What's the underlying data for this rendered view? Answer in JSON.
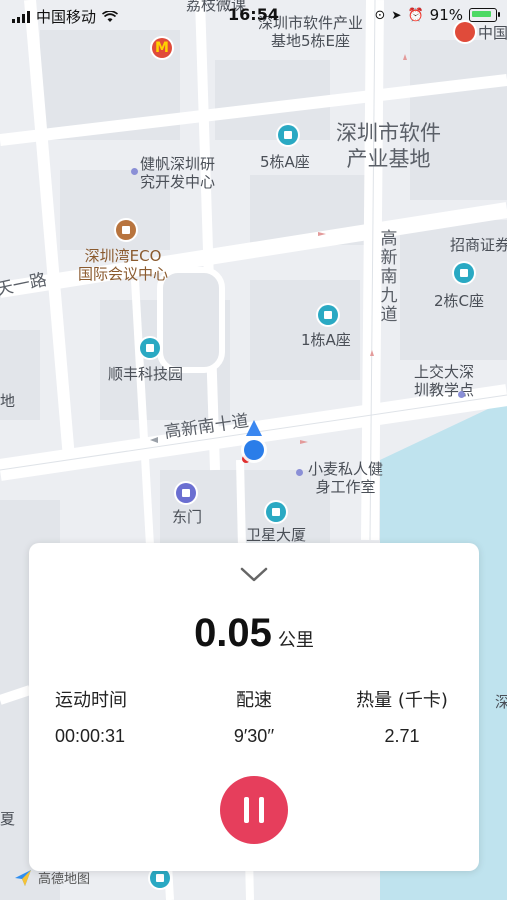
{
  "status_bar": {
    "carrier": "中国移动",
    "time": "16:54",
    "battery": "91%"
  },
  "map": {
    "labels": [
      {
        "text": "深圳市软件产业\n基地5栋E座",
        "style": "normal"
      },
      {
        "text": "深圳市软件\n产业基地",
        "style": "big"
      },
      {
        "text": "健帆深圳研\n究开发中心",
        "style": "normal"
      },
      {
        "text": "5栋A座",
        "style": "normal"
      },
      {
        "text": "深圳湾ECO\n国际会议中心",
        "style": "normal"
      },
      {
        "text": "招商证券",
        "style": "normal"
      },
      {
        "text": "2栋C座",
        "style": "normal"
      },
      {
        "text": "1栋A座",
        "style": "normal"
      },
      {
        "text": "顺丰科技园",
        "style": "normal"
      },
      {
        "text": "上交大深\n圳教学点",
        "style": "normal"
      },
      {
        "text": "小麦私人健\n身工作室",
        "style": "normal"
      },
      {
        "text": "东门",
        "style": "normal"
      },
      {
        "text": "卫星大厦",
        "style": "normal"
      },
      {
        "text": "荔枝微课",
        "style": "normal"
      },
      {
        "text": "中国",
        "style": "normal"
      },
      {
        "text": "地",
        "style": "normal"
      },
      {
        "text": "夏",
        "style": "normal"
      },
      {
        "text": "深",
        "style": "normal"
      },
      {
        "text": "高新南九道",
        "style": "road"
      },
      {
        "text": "高新南十道",
        "style": "road"
      },
      {
        "text": "天一路",
        "style": "road"
      }
    ],
    "attribution": "高德地图"
  },
  "workout": {
    "distance_value": "0.05",
    "distance_unit": "公里",
    "stats": [
      {
        "label": "运动时间",
        "value": "00:00:31"
      },
      {
        "label": "配速",
        "value": "9′30′′"
      },
      {
        "label": "热量 (千卡)",
        "value": "2.71"
      }
    ]
  },
  "colors": {
    "accent": "#e63e5c",
    "water": "#bfe3ee",
    "road": "#ffffff",
    "user": "#2a7de9"
  }
}
